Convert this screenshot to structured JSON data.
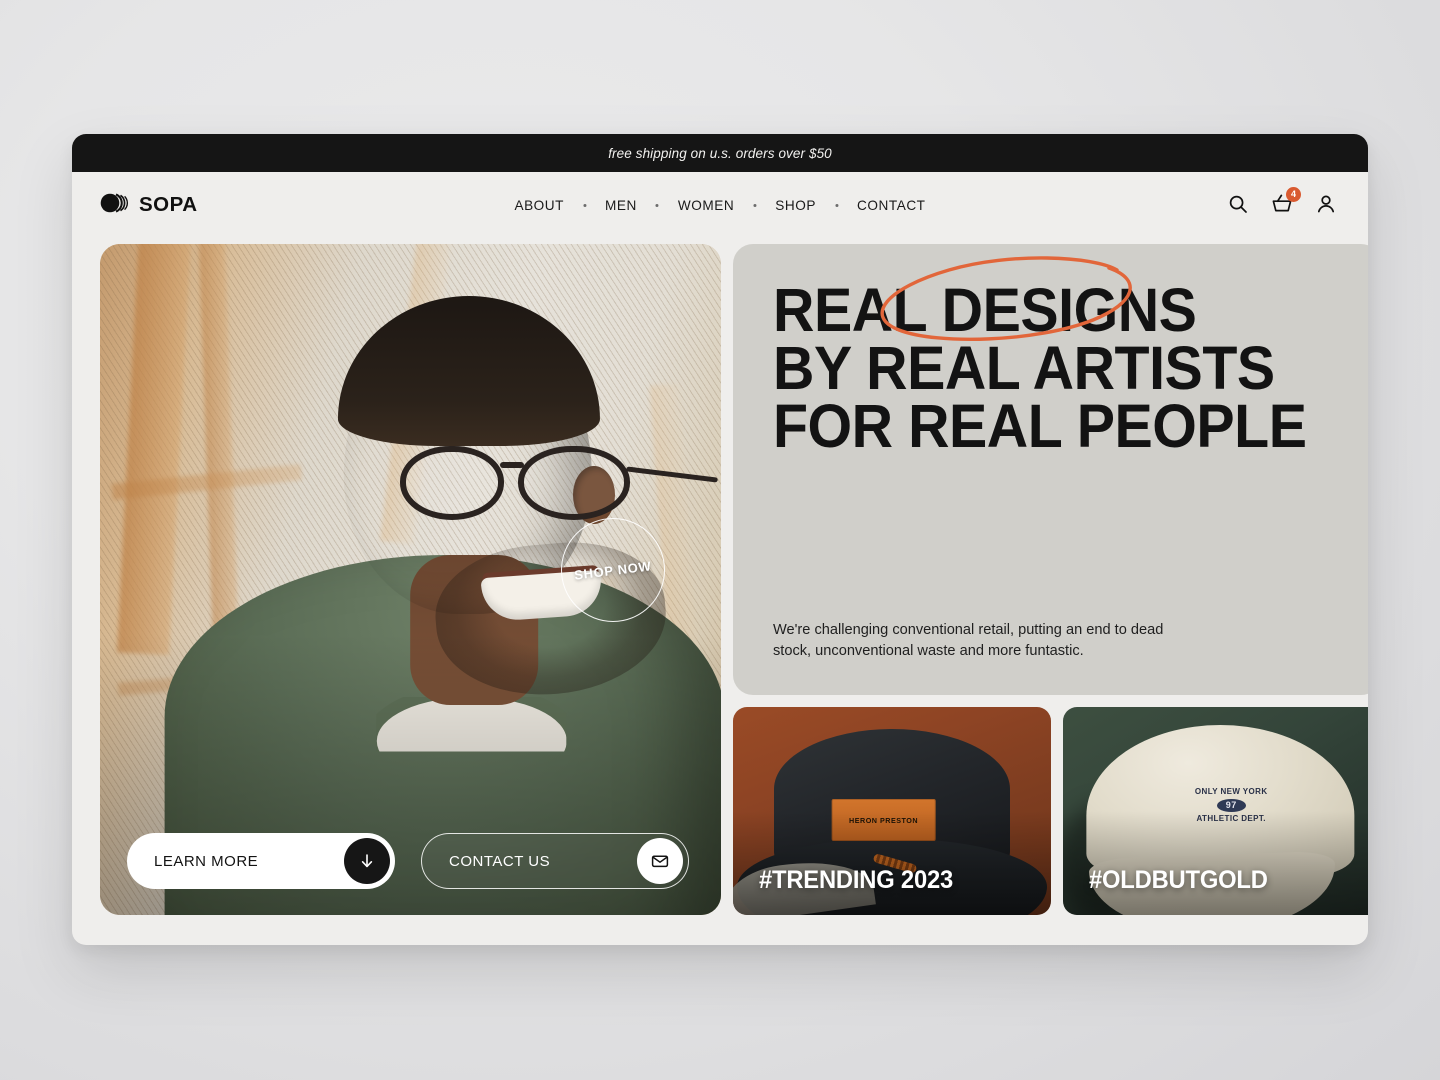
{
  "announcement": {
    "text": "free shipping on u.s. orders over $50"
  },
  "header": {
    "brand": "SOPA",
    "brand_icon": "concentric-circles-logo",
    "nav": [
      {
        "label": "ABOUT"
      },
      {
        "label": "MEN"
      },
      {
        "label": "WOMEN"
      },
      {
        "label": "SHOP"
      },
      {
        "label": "CONTACT"
      }
    ],
    "actions": {
      "search_icon": "search-icon",
      "cart_icon": "shopping-basket-icon",
      "cart_count": "4",
      "account_icon": "user-icon"
    }
  },
  "hero": {
    "image_alt": "Smiling man wearing glasses and a green sweatshirt",
    "shop_now": "SHOP NOW",
    "buttons": {
      "learn_more": "LEARN MORE",
      "learn_more_icon": "arrow-down-icon",
      "contact_us": "CONTACT US",
      "contact_us_icon": "envelope-icon"
    }
  },
  "headline_card": {
    "line1": "REAL DESIGNS",
    "line2": "BY REAL ARTISTS",
    "line3": "FOR REAL PEOPLE",
    "annotation": "hand-drawn-ellipse-around-designs",
    "subtext": "We're challenging conventional retail, putting an end to dead stock, unconventional waste and more funtastic."
  },
  "product_cards": [
    {
      "tag": "#TRENDING 2023",
      "image_alt": "Black bucket hat with orange Heron Preston label",
      "hat_label": "HERON PRESTON"
    },
    {
      "tag": "#OLDBUTGOLD",
      "image_alt": "Cream cap with Only New York 97 Athletic Dept embroidery",
      "cap_line1": "ONLY NEW YORK",
      "cap_badge": "97",
      "cap_line2": "ATHLETIC DEPT."
    }
  ],
  "colors": {
    "accent_orange": "#d95a30",
    "annotation_orange": "#e2663a",
    "dark": "#151515",
    "page_bg": "#efeeec",
    "card_bg": "#d0cfca"
  }
}
